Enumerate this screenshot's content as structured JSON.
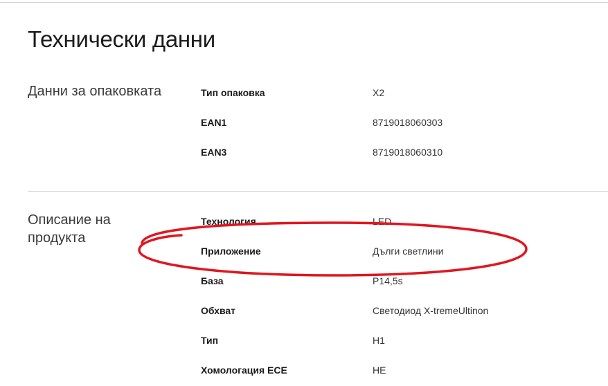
{
  "page": {
    "title": "Технически данни"
  },
  "sections": [
    {
      "title": "Данни за опаковката",
      "rows": [
        {
          "label": "Тип опаковка",
          "value": "X2"
        },
        {
          "label": "EAN1",
          "value": "8719018060303"
        },
        {
          "label": "EAN3",
          "value": "8719018060310"
        }
      ]
    },
    {
      "title": "Описание на продукта",
      "rows": [
        {
          "label": "Технология",
          "value": "LED"
        },
        {
          "label": "Приложение",
          "value": "Дълги светлини"
        },
        {
          "label": "База",
          "value": "P14,5s"
        },
        {
          "label": "Обхват",
          "value": "Светодиод X-tremeUltinon"
        },
        {
          "label": "Тип",
          "value": "H1"
        },
        {
          "label": "Хомологация ECE",
          "value": "НЕ"
        }
      ]
    }
  ],
  "annotation": {
    "color": "#e0161f",
    "shape": "ellipse",
    "target": "Приложение"
  }
}
